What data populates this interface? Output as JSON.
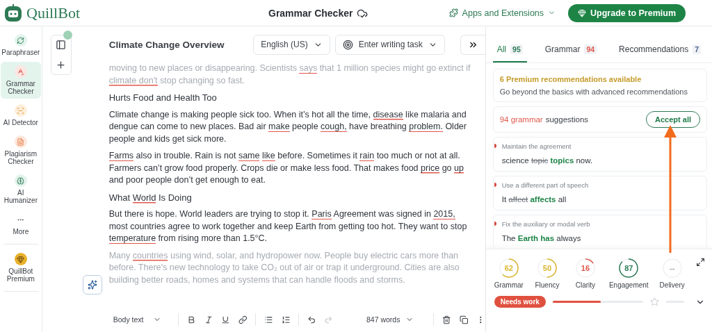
{
  "header": {
    "brand": "QuillBot",
    "title": "Grammar Checker",
    "apps_link": "Apps and Extensions",
    "upgrade_button": "Upgrade to Premium"
  },
  "sidebar": {
    "items": [
      {
        "label": "Paraphraser",
        "selected": false
      },
      {
        "label": "Grammar Checker",
        "selected": true
      },
      {
        "label": "AI Detector",
        "selected": false
      },
      {
        "label": "Plagiarism Checker",
        "selected": false
      },
      {
        "label": "AI Humanizer",
        "selected": false
      },
      {
        "label": "More",
        "selected": false
      }
    ],
    "premium": "QuillBot Premium"
  },
  "editor": {
    "title": "Climate Change Overview",
    "language": "English (US)",
    "writing_task": "Enter writing task",
    "paragraphs": [
      {
        "kind": "text",
        "faded": true,
        "segments": [
          {
            "text": "moving to new places or disappearing. Scientists ",
            "flagged": false
          },
          {
            "text": "says",
            "flagged": true
          },
          {
            "text": " that 1 million species might go extinct if ",
            "flagged": false
          },
          {
            "text": "climate don't",
            "flagged": true
          },
          {
            "text": " stop changing so fast.",
            "flagged": false
          }
        ]
      },
      {
        "kind": "heading",
        "faded": false,
        "segments": [
          {
            "text": "Hurts Food and Health Too",
            "flagged": false
          }
        ]
      },
      {
        "kind": "text",
        "faded": false,
        "segments": [
          {
            "text": "Climate change is making people sick too. When it’s hot all the time, ",
            "flagged": false
          },
          {
            "text": "disease",
            "flagged": true
          },
          {
            "text": " like malaria and dengue can come to new places. Bad air ",
            "flagged": false
          },
          {
            "text": "make",
            "flagged": true
          },
          {
            "text": " people ",
            "flagged": false
          },
          {
            "text": "cough,",
            "flagged": true
          },
          {
            "text": " have breathing ",
            "flagged": false
          },
          {
            "text": "problem.",
            "flagged": true
          },
          {
            "text": " Older people and kids get sick more.",
            "flagged": false
          }
        ]
      },
      {
        "kind": "text",
        "faded": false,
        "segments": [
          {
            "text": "Farms",
            "flagged": true
          },
          {
            "text": " also in trouble. Rain is not ",
            "flagged": false
          },
          {
            "text": "same",
            "flagged": true
          },
          {
            "text": "like",
            "flagged": true
          },
          {
            "text": " before. Sometimes it ",
            "flagged": false
          },
          {
            "text": "rain",
            "flagged": true
          },
          {
            "text": " too much or not at all. Farmers can’t grow food properly. Crops die or make less food. That makes food ",
            "flagged": false
          },
          {
            "text": "price",
            "flagged": true
          },
          {
            "text": " go ",
            "flagged": false
          },
          {
            "text": "up",
            "flagged": true
          },
          {
            "text": " and poor people don’t get enough to eat.",
            "flagged": false
          }
        ]
      },
      {
        "kind": "heading",
        "faded": false,
        "segments": [
          {
            "text": "What ",
            "flagged": false
          },
          {
            "text": "World",
            "flagged": true
          },
          {
            "text": " Is Doing",
            "flagged": false
          }
        ]
      },
      {
        "kind": "text",
        "faded": false,
        "segments": [
          {
            "text": "But there is hope. World leaders are trying to stop it. ",
            "flagged": false
          },
          {
            "text": "Paris",
            "flagged": true
          },
          {
            "text": " Agreement was signed in ",
            "flagged": false
          },
          {
            "text": "2015,",
            "flagged": true
          },
          {
            "text": " most countries agree to work together and keep Earth from getting too hot. They want to stop ",
            "flagged": false
          },
          {
            "text": "temperature",
            "flagged": true
          },
          {
            "text": " from rising more than 1.5°C.",
            "flagged": false
          }
        ]
      },
      {
        "kind": "text",
        "faded": true,
        "segments": [
          {
            "text": "Many ",
            "flagged": false
          },
          {
            "text": "countries",
            "flagged": true
          },
          {
            "text": " using wind, solar, and hydropower now. People buy electric cars more than before. There’s new technology to take CO₂ out of air or trap it underground. Cities are also building better roads, homes and systems that can handle floods and storms.",
            "flagged": false
          }
        ]
      }
    ],
    "toolbar": {
      "style": "Body text",
      "word_count": "847 words"
    }
  },
  "panel": {
    "tabs": [
      {
        "label": "All",
        "count": "95",
        "selected": true,
        "color": "#2d7a55"
      },
      {
        "label": "Grammar",
        "count": "94",
        "selected": false,
        "color": "#e0574a"
      },
      {
        "label": "Recommendations",
        "count": "7",
        "selected": false,
        "color": "#4a5f8a"
      }
    ],
    "premium_card": {
      "title": "6 Premium recommendations available",
      "text": "Go beyond the basics with advanced recommendations"
    },
    "summary": {
      "count_label": "94 grammar",
      "label": "suggestions",
      "button": "Accept all"
    },
    "suggestions": [
      {
        "hint": "Maintain the agreement",
        "parts": [
          {
            "text": "science ",
            "kind": "plain"
          },
          {
            "text": "topic",
            "kind": "removed"
          },
          {
            "text": "topics",
            "kind": "added"
          },
          {
            "text": " now.",
            "kind": "plain"
          }
        ]
      },
      {
        "hint": "Use a different part of speech",
        "parts": [
          {
            "text": "It ",
            "kind": "plain"
          },
          {
            "text": "affect",
            "kind": "removed"
          },
          {
            "text": "affects",
            "kind": "added"
          },
          {
            "text": " all",
            "kind": "plain"
          }
        ]
      },
      {
        "hint": "Fix the auxiliary or modal verb",
        "parts": [
          {
            "text": "The ",
            "kind": "plain"
          },
          {
            "text": "Earth has",
            "kind": "added"
          },
          {
            "text": " always",
            "kind": "plain"
          }
        ]
      }
    ],
    "scores": [
      {
        "value": "62",
        "label": "Grammar",
        "color": "#d9b52c"
      },
      {
        "value": "50",
        "label": "Fluency",
        "color": "#d9b52c"
      },
      {
        "value": "16",
        "label": "Clarity",
        "color": "#e0574a"
      },
      {
        "value": "87",
        "label": "Engagement",
        "color": "#2d7a55"
      },
      {
        "value": "--",
        "label": "Delivery",
        "color": "#9aa0a6"
      }
    ],
    "rating": {
      "badge": "Needs work",
      "level": 0.53
    }
  }
}
